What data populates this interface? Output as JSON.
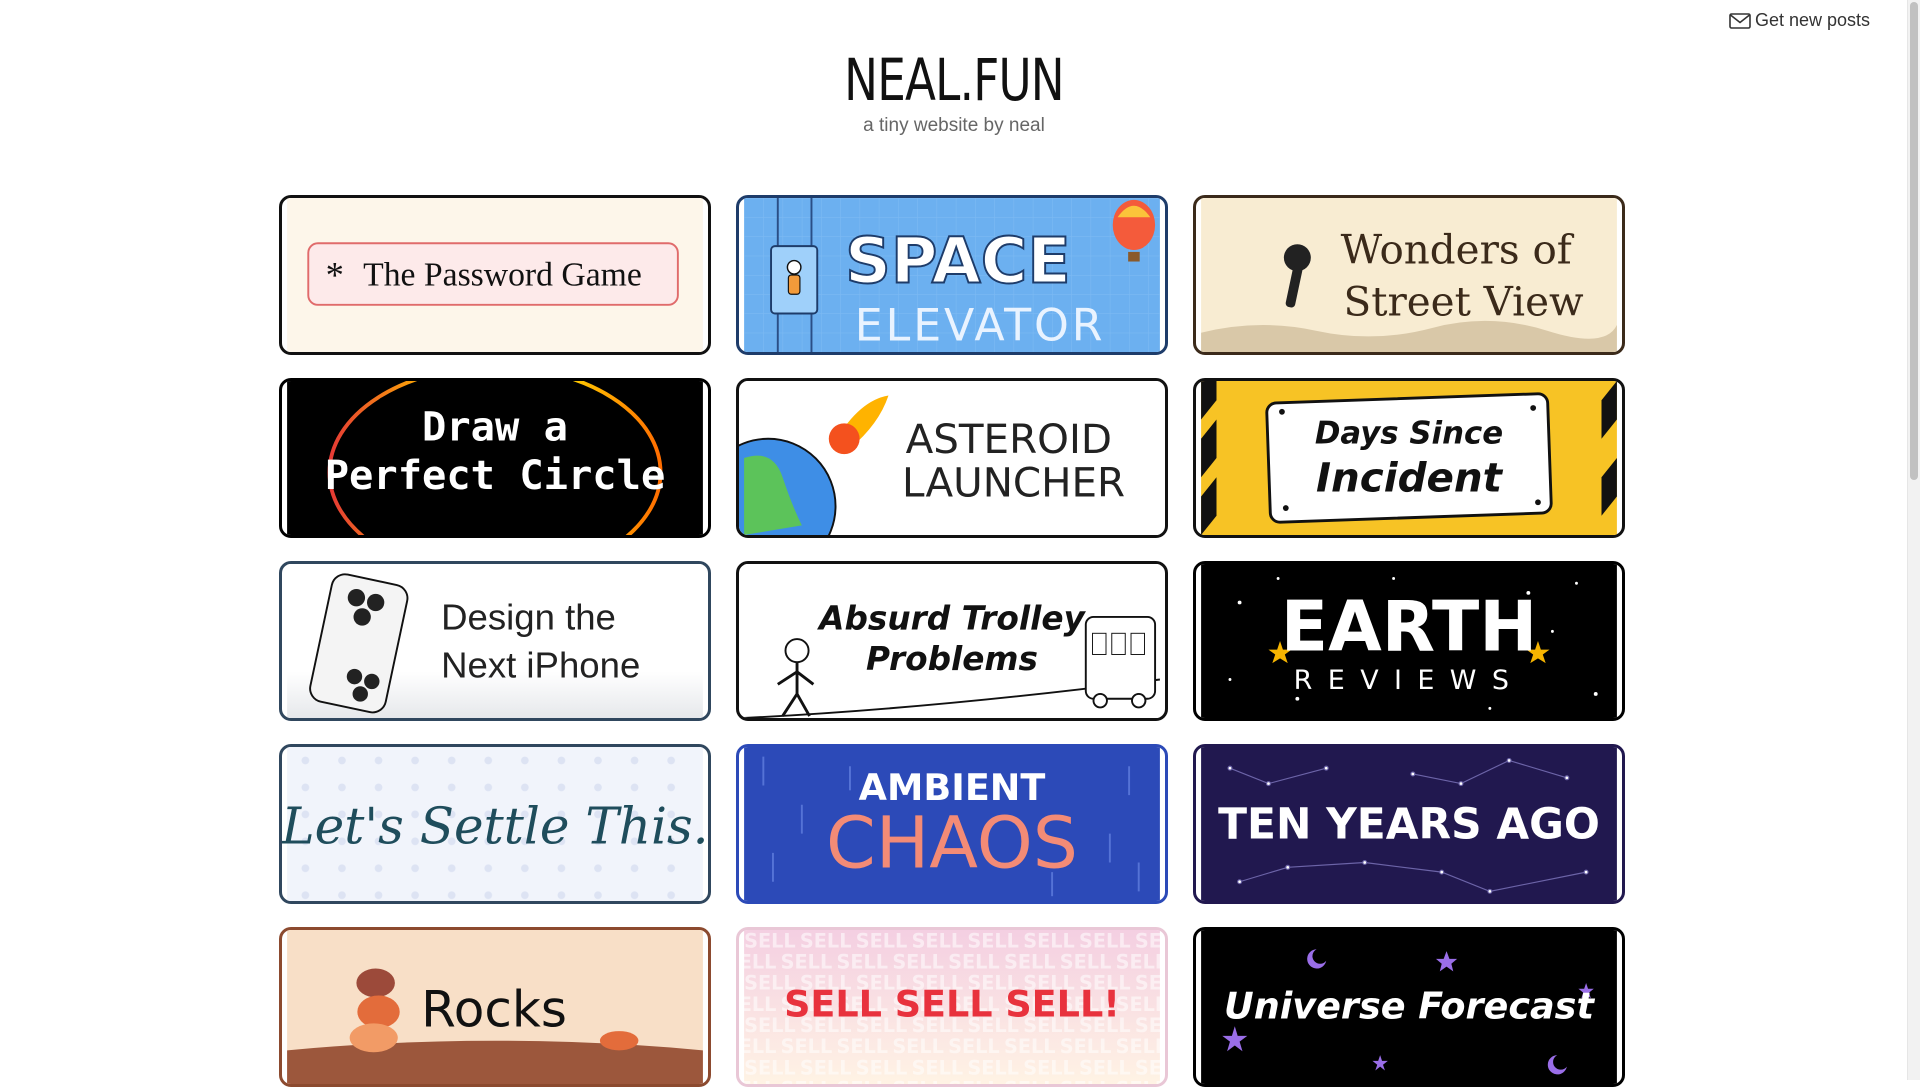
{
  "subscribe": {
    "label": "Get new posts",
    "icon": "mail-icon"
  },
  "header": {
    "title": "NEAL.FUN",
    "subtitle": "a tiny website by neal"
  },
  "cards": [
    {
      "title": "The Password Game",
      "star": "*"
    },
    {
      "title_line1": "SPACE",
      "title_line2": "ELEVATOR"
    },
    {
      "title_line1": "Wonders of",
      "title_line2": "Street View"
    },
    {
      "title_line1": "Draw a",
      "title_line2": "Perfect Circle"
    },
    {
      "title_line1": "ASTEROID",
      "title_line2": "LAUNCHER"
    },
    {
      "title_line1": "Days Since",
      "title_line2": "Incident"
    },
    {
      "title_line1": "Design the",
      "title_line2": "Next iPhone"
    },
    {
      "title_line1": "Absurd Trolley",
      "title_line2": "Problems"
    },
    {
      "title_line1": "EARTH",
      "title_line2": "REVIEWS"
    },
    {
      "title": "Let's Settle This."
    },
    {
      "title_line1": "AMBIENT",
      "title_line2": "CHAOS"
    },
    {
      "title": "TEN YEARS AGO"
    },
    {
      "title": "Rocks"
    },
    {
      "title": "SELL SELL SELL!",
      "bg_word": "SELL"
    },
    {
      "title": "Universe Forecast"
    }
  ],
  "colors": {
    "password_bg": "#fdf6ea",
    "space_bg": "#6cb0f0",
    "street_bg": "#f8ecd2",
    "trolley_bg": "#ffffff",
    "incident_bg": "#f7c325",
    "earth_bg": "#000000",
    "settle_bg": "#f1f4fb",
    "ambient_bg": "#2c4ab8",
    "ambient_accent": "#f38b76",
    "tenyears_bg": "#21184f",
    "rocks_bg": "#f8dfc7",
    "sell_accent": "#e8323d",
    "universe_bg": "#000000"
  }
}
